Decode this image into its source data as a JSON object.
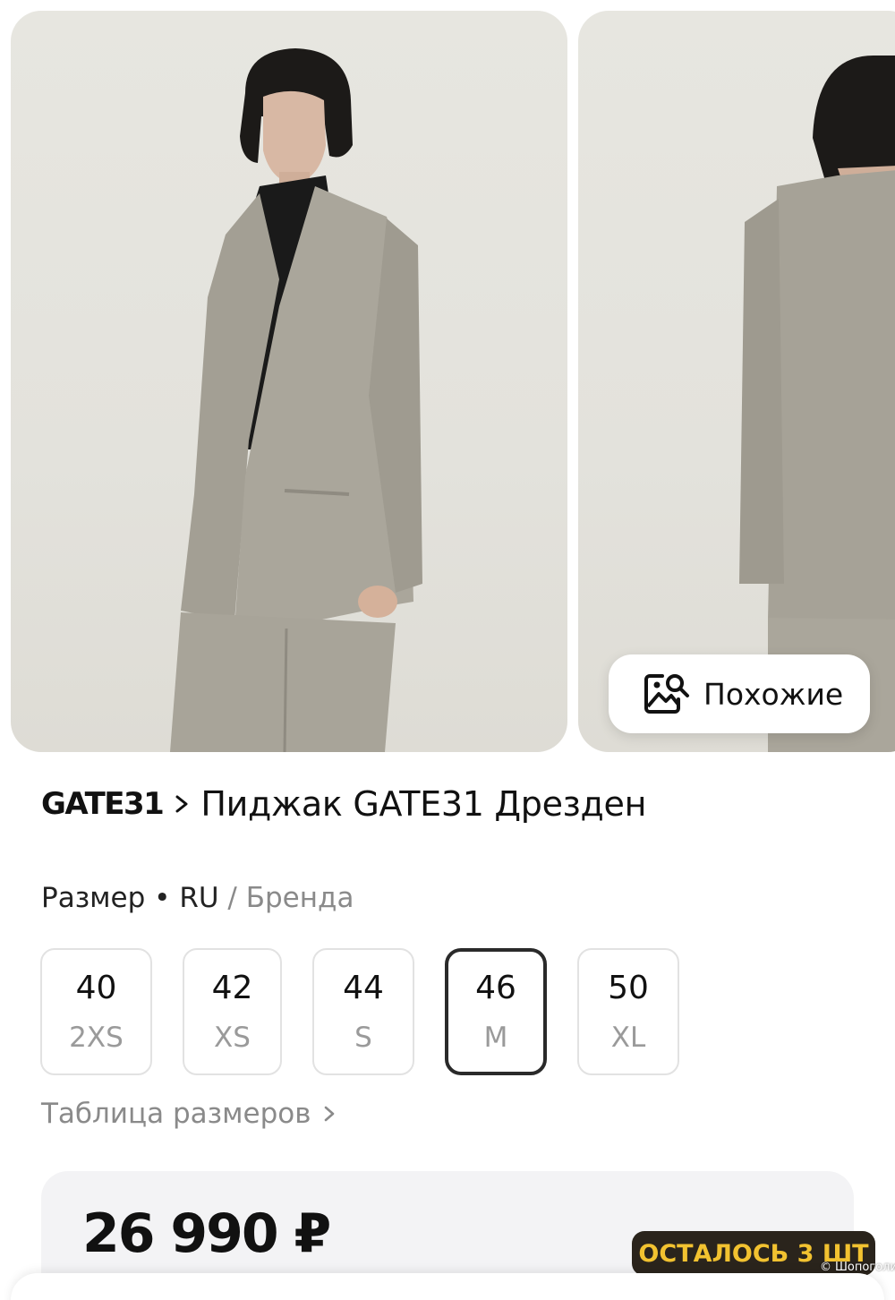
{
  "gallery": {
    "similar_label": "Похожие"
  },
  "product": {
    "brand": "GATE31",
    "name": "Пиджак GATE31 Дрезден"
  },
  "size": {
    "label": "Размер",
    "separator": "•",
    "system_active": "RU",
    "system_divider": "/",
    "system_alt": "Бренда",
    "options": [
      {
        "ru": "40",
        "intl": "2XS",
        "selected": false
      },
      {
        "ru": "42",
        "intl": "XS",
        "selected": false
      },
      {
        "ru": "44",
        "intl": "S",
        "selected": false
      },
      {
        "ru": "46",
        "intl": "M",
        "selected": true
      },
      {
        "ru": "50",
        "intl": "XL",
        "selected": false
      }
    ],
    "table_link": "Таблица размеров"
  },
  "price": {
    "amount": "26 990 ₽",
    "stock_badge": "ОСТАЛОСЬ 3 ШТ"
  },
  "watermark": {
    "symbol": "©",
    "text": "Шопоголик"
  },
  "colors": {
    "stock_badge_bg": "#2a241c",
    "stock_badge_text": "#f2c230",
    "selected_border": "#2a2a2a"
  }
}
